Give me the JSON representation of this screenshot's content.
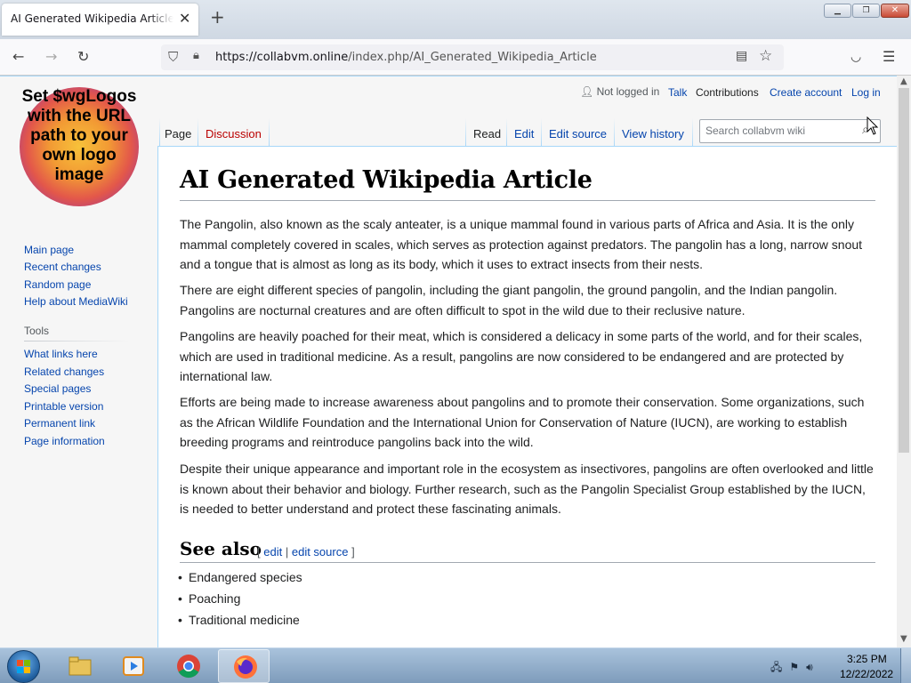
{
  "browser": {
    "tab_title": "AI Generated Wikipedia Article - collabvm wiki",
    "new_tab": "+",
    "close_tab": "✕",
    "url_host": "https://collabvm.online",
    "url_path": "/index.php/AI_Generated_Wikipedia_Article"
  },
  "wiki": {
    "logo_text": "Set $wgLogos with the URL path to your own logo image",
    "personal": {
      "not_logged_in": "Not logged in",
      "talk": "Talk",
      "contributions": "Contributions",
      "create_account": "Create account",
      "log_in": "Log in"
    },
    "tabs": {
      "page": "Page",
      "discussion": "Discussion",
      "read": "Read",
      "edit": "Edit",
      "edit_source": "Edit source",
      "view_history": "View history"
    },
    "search_placeholder": "Search collabvm wiki",
    "nav": [
      "Main page",
      "Recent changes",
      "Random page",
      "Help about MediaWiki"
    ],
    "tools_heading": "Tools",
    "tools": [
      "What links here",
      "Related changes",
      "Special pages",
      "Printable version",
      "Permanent link",
      "Page information"
    ],
    "title": "AI Generated Wikipedia Article",
    "paragraphs": [
      "The Pangolin, also known as the scaly anteater, is a unique mammal found in various parts of Africa and Asia. It is the only mammal completely covered in scales, which serves as protection against predators. The pangolin has a long, narrow snout and a tongue that is almost as long as its body, which it uses to extract insects from their nests.",
      "There are eight different species of pangolin, including the giant pangolin, the ground pangolin, and the Indian pangolin. Pangolins are nocturnal creatures and are often difficult to spot in the wild due to their reclusive nature.",
      "Pangolins are heavily poached for their meat, which is considered a delicacy in some parts of the world, and for their scales, which are used in traditional medicine. As a result, pangolins are now considered to be endangered and are protected by international law.",
      "Efforts are being made to increase awareness about pangolins and to promote their conservation. Some organizations, such as the African Wildlife Foundation and the International Union for Conservation of Nature (IUCN), are working to establish breeding programs and reintroduce pangolins back into the wild.",
      "Despite their unique appearance and important role in the ecosystem as insectivores, pangolins are often overlooked and little is known about their behavior and biology. Further research, such as the Pangolin Specialist Group established by the IUCN, is needed to better understand and protect these fascinating animals."
    ],
    "see_also": {
      "heading": "See also",
      "bracket_open": "[",
      "edit": "edit",
      "sep": "|",
      "edit_source": "edit source",
      "bracket_close": "]",
      "items": [
        "Endangered species",
        "Poaching",
        "Traditional medicine"
      ]
    }
  },
  "taskbar": {
    "time": "3:25 PM",
    "date": "12/22/2022"
  }
}
